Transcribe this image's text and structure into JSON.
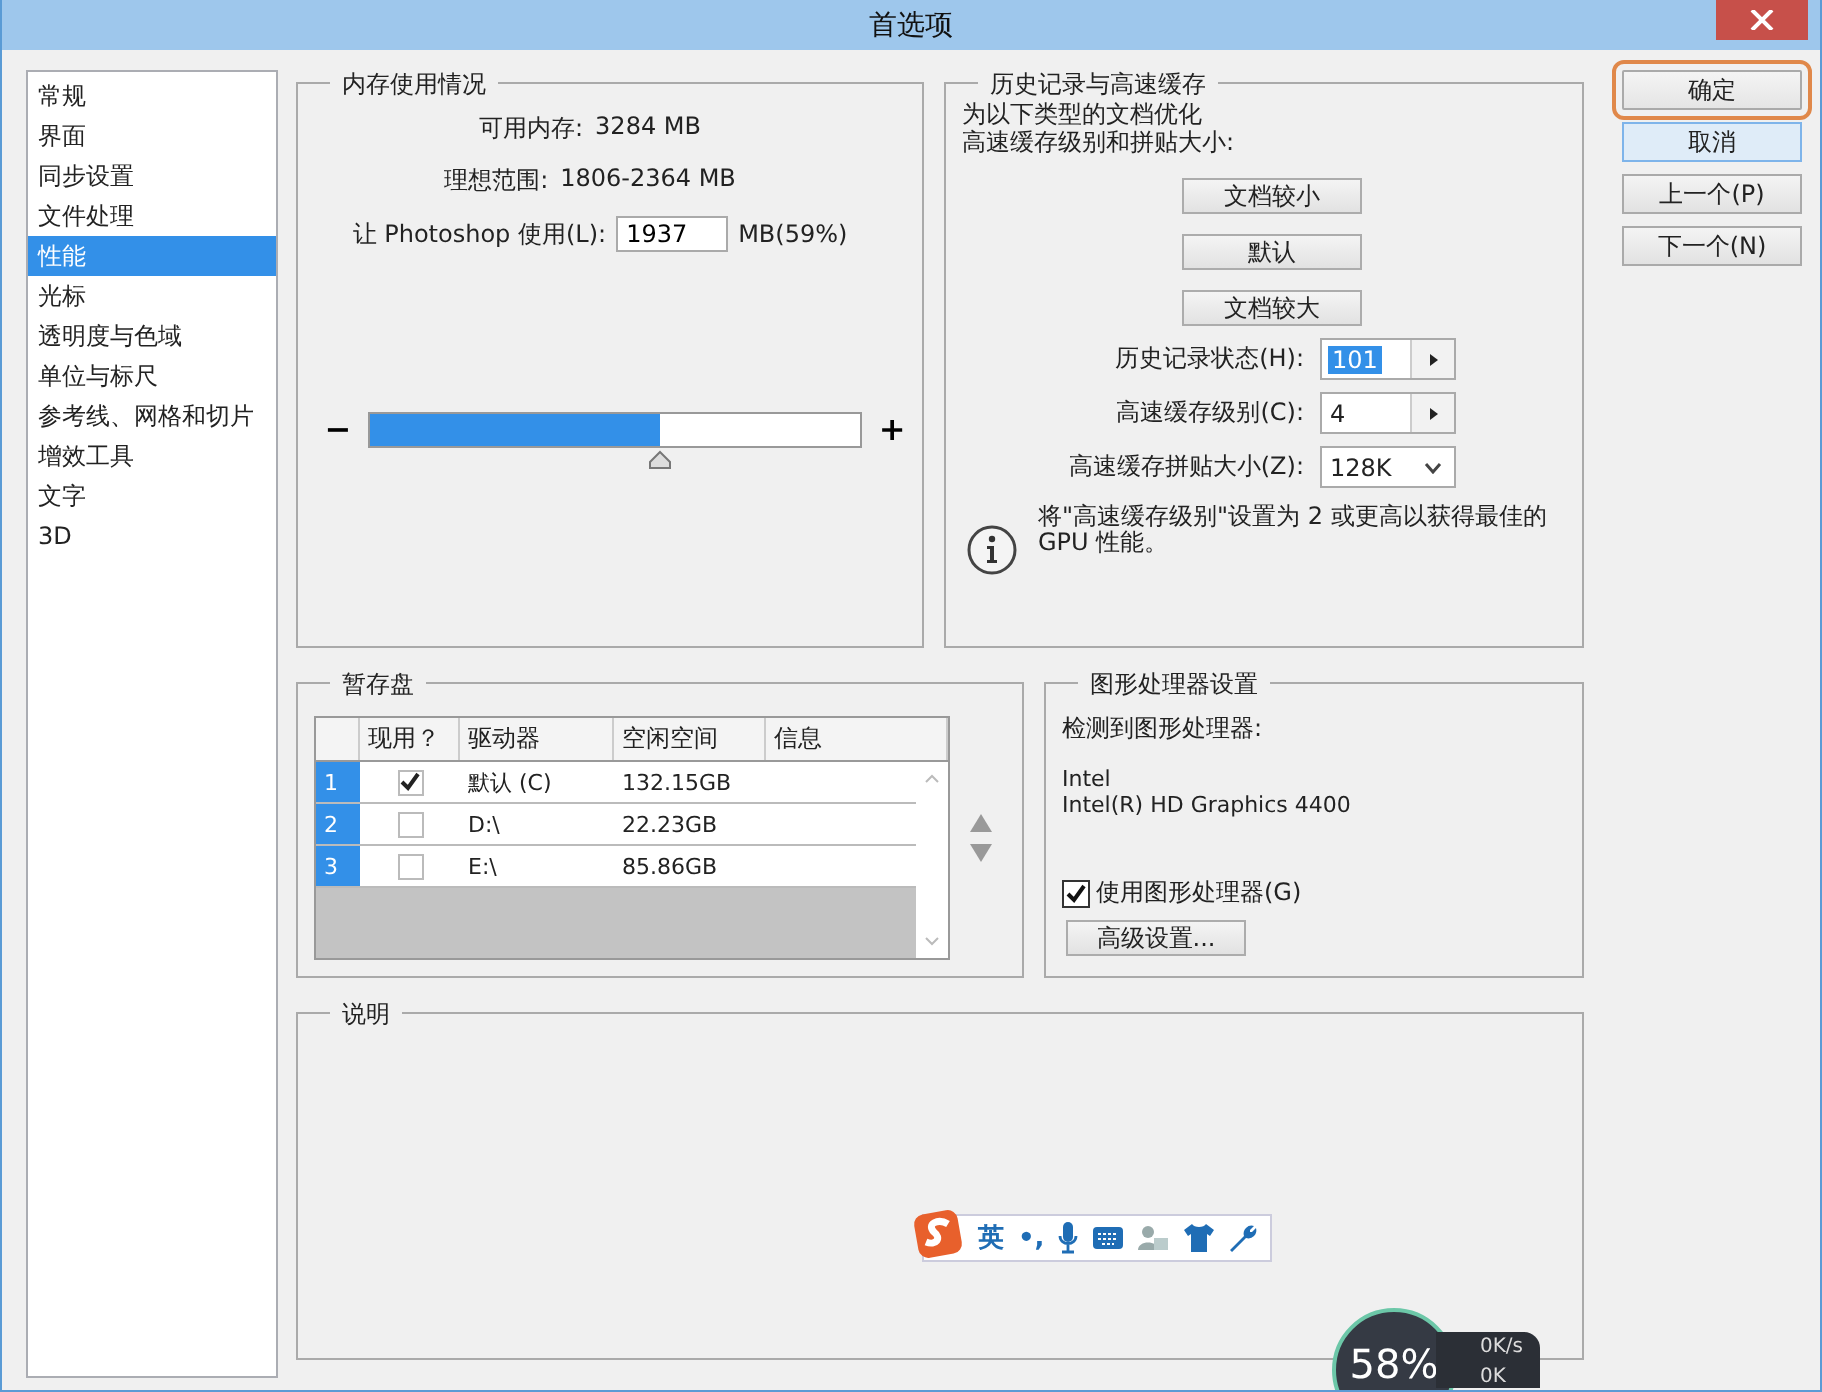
{
  "window": {
    "title": "首选项"
  },
  "sidebar": {
    "items": [
      {
        "label": "常规",
        "selected": false
      },
      {
        "label": "界面",
        "selected": false
      },
      {
        "label": "同步设置",
        "selected": false
      },
      {
        "label": "文件处理",
        "selected": false
      },
      {
        "label": "性能",
        "selected": true
      },
      {
        "label": "光标",
        "selected": false
      },
      {
        "label": "透明度与色域",
        "selected": false
      },
      {
        "label": "单位与标尺",
        "selected": false
      },
      {
        "label": "参考线、网格和切片",
        "selected": false
      },
      {
        "label": "增效工具",
        "selected": false
      },
      {
        "label": "文字",
        "selected": false
      },
      {
        "label": "3D",
        "selected": false
      }
    ]
  },
  "memory": {
    "title": "内存使用情况",
    "available_label": "可用内存:",
    "available_value": "3284 MB",
    "range_label": "理想范围:",
    "range_value": "1806-2364 MB",
    "use_label": "让 Photoshop 使用(L):",
    "use_value": "1937",
    "use_unit": "MB(59%)",
    "minus": "−",
    "plus": "+",
    "slider": {
      "level": 0.59
    }
  },
  "history": {
    "title": "历史记录与高速缓存",
    "description": [
      "为以下类型的文档优化",
      "高速缓存级别和拼贴大小:"
    ],
    "preset_buttons": [
      "文档较小",
      "默认",
      "文档较大"
    ],
    "fields": [
      {
        "label": "历史记录状态(H):",
        "value": "101",
        "kind": "spinner",
        "selected": true
      },
      {
        "label": "高速缓存级别(C):",
        "value": "4",
        "kind": "spinner",
        "selected": false
      },
      {
        "label": "高速缓存拼贴大小(Z):",
        "value": "128K",
        "kind": "dropdown",
        "selected": false
      }
    ],
    "info": "将\"高速缓存级别\"设置为 2 或更高以获得最佳的 GPU 性能。"
  },
  "scratch": {
    "title": "暂存盘",
    "columns": [
      "现用？",
      "驱动器",
      "空闲空间",
      "信息"
    ],
    "rows": [
      {
        "index": "1",
        "checked": true,
        "drive": "默认 (C)",
        "free": "132.15GB"
      },
      {
        "index": "2",
        "checked": false,
        "drive": "D:\\",
        "free": "22.23GB"
      },
      {
        "index": "3",
        "checked": false,
        "drive": "E:\\",
        "free": "85.86GB"
      }
    ]
  },
  "gpu": {
    "title": "图形处理器设置",
    "detected_label": "检测到图形处理器:",
    "vendor": "Intel",
    "model": "Intel(R) HD Graphics 4400",
    "use_gpu": {
      "label": "使用图形处理器(G)",
      "checked": true
    },
    "advanced_button": "高级设置..."
  },
  "description": {
    "title": "说明"
  },
  "buttons": [
    {
      "label": "确定",
      "highlighted": true
    },
    {
      "label": "取消",
      "highlighted": false
    },
    {
      "label": "上一个(P)",
      "highlighted": false
    },
    {
      "label": "下一个(N)",
      "highlighted": false
    }
  ],
  "ime_toolbar": {
    "mode": "英",
    "punctuation": "•,"
  },
  "net_meter": {
    "percent": "58%",
    "speeds": [
      "0K/s",
      "0K"
    ]
  }
}
